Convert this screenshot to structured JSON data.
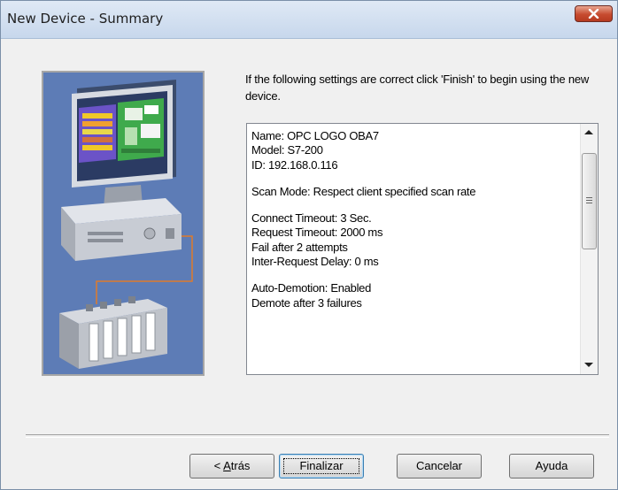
{
  "window": {
    "title": "New Device - Summary"
  },
  "intro": {
    "text": "If the following settings are correct click 'Finish' to begin using the new device."
  },
  "summary": {
    "lines": [
      "Name: OPC LOGO OBA7",
      "Model: S7-200",
      "ID: 192.168.0.116",
      "",
      "Scan Mode: Respect client specified scan rate",
      "",
      "Connect Timeout: 3 Sec.",
      "Request Timeout: 2000 ms",
      "Fail after 2 attempts",
      "Inter-Request Delay: 0 ms",
      "",
      "Auto-Demotion: Enabled",
      "Demote after 3 failures"
    ]
  },
  "buttons": {
    "back_prefix": "< ",
    "back_mnemonic": "A",
    "back_rest": "trás",
    "finish": "Finalizar",
    "cancel": "Cancelar",
    "help": "Ayuda"
  }
}
